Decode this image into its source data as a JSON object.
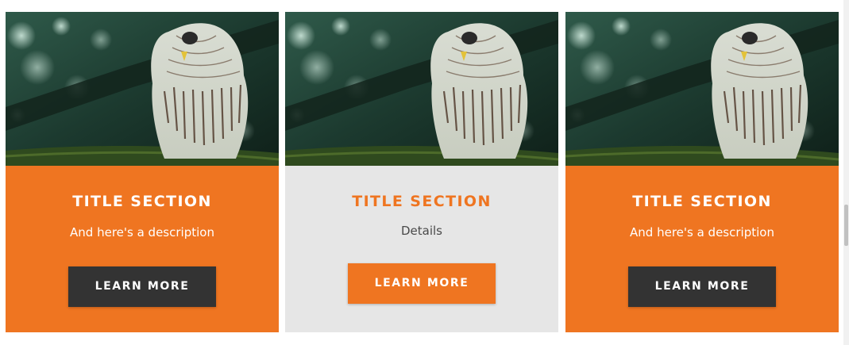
{
  "cards": [
    {
      "title": "TITLE SECTION",
      "description": "And here's a description",
      "button_label": "LEARN MORE",
      "image": "owl-photo",
      "style": "orange"
    },
    {
      "title": "TITLE SECTION",
      "description": "Details",
      "button_label": "LEARN MORE",
      "image": "owl-photo",
      "style": "grey"
    },
    {
      "title": "TITLE SECTION",
      "description": "And here's a description",
      "button_label": "LEARN MORE",
      "image": "owl-photo",
      "style": "orange"
    }
  ],
  "colors": {
    "accent": "#ef7521",
    "dark_button": "#333333",
    "grey_panel": "#e6e6e6"
  }
}
